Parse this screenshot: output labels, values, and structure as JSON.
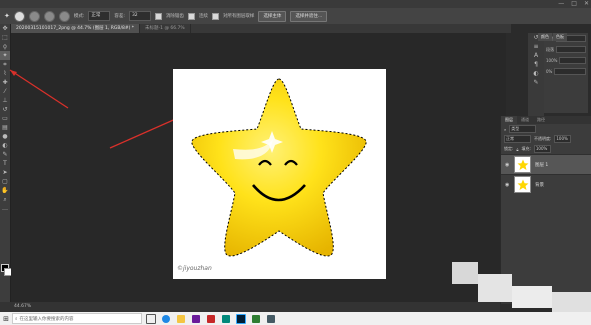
{
  "options_bar": {
    "mode_label": "模式:",
    "mode_value": "正常",
    "sample_label": "容差:",
    "sample_value": "32",
    "anti_alias_label": "消除锯齿",
    "contiguous_label": "连续",
    "all_layers_label": "对所有图层取样",
    "select_subject_label": "选择主体",
    "select_mask_label": "选择并遮住..."
  },
  "tabs": [
    {
      "label": "20200315101017_2png @ 44.7% (图层 1, RGB/8#) *",
      "active": true
    },
    {
      "label": "未标题-1 @ 66.7%",
      "active": false
    }
  ],
  "status": {
    "zoom": "44.67%"
  },
  "right_panel": {
    "tabs": [
      "颜色",
      "色板"
    ],
    "rows": [
      "字符",
      "段落",
      "100%",
      "0%"
    ]
  },
  "layers": {
    "tabs": [
      "图层",
      "通道",
      "路径"
    ],
    "kind_label": "类型",
    "blend_mode": "正常",
    "opacity_label": "不透明度:",
    "opacity_value": "100%",
    "fill_label": "填充:",
    "fill_value": "100%",
    "lock_label": "锁定:",
    "items": [
      {
        "name": "图层 1",
        "selected": true
      },
      {
        "name": "背景",
        "selected": false
      }
    ]
  },
  "taskbar": {
    "search_placeholder": "在这里输入你要搜索的内容"
  },
  "canvas": {
    "watermark_text": "©jiyouzhan"
  },
  "colors": {
    "star_light": "#FFF176",
    "star_dark": "#E6B400",
    "selection_stroke": "#000000"
  }
}
